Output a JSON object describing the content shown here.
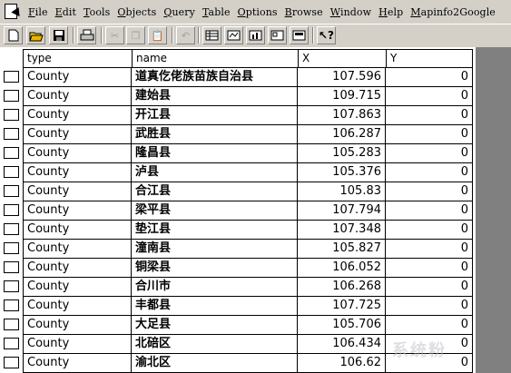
{
  "menu": [
    "File",
    "Edit",
    "Tools",
    "Objects",
    "Query",
    "Table",
    "Options",
    "Browse",
    "Window",
    "Help",
    "Mapinfo2Google"
  ],
  "columns": {
    "type": "type",
    "name": "name",
    "x": "X",
    "y": "Y"
  },
  "rows": [
    {
      "type": "County",
      "name": "道真仡佬族苗族自治县",
      "x": "107.596",
      "y": "0"
    },
    {
      "type": "County",
      "name": "建始县",
      "x": "109.715",
      "y": "0"
    },
    {
      "type": "County",
      "name": "开江县",
      "x": "107.863",
      "y": "0"
    },
    {
      "type": "County",
      "name": "武胜县",
      "x": "106.287",
      "y": "0"
    },
    {
      "type": "County",
      "name": "隆昌县",
      "x": "105.283",
      "y": "0"
    },
    {
      "type": "County",
      "name": "泸县",
      "x": "105.376",
      "y": "0"
    },
    {
      "type": "County",
      "name": "合江县",
      "x": "105.83",
      "y": "0"
    },
    {
      "type": "County",
      "name": "梁平县",
      "x": "107.794",
      "y": "0"
    },
    {
      "type": "County",
      "name": "垫江县",
      "x": "107.348",
      "y": "0"
    },
    {
      "type": "County",
      "name": "潼南县",
      "x": "105.827",
      "y": "0"
    },
    {
      "type": "County",
      "name": "铜梁县",
      "x": "106.052",
      "y": "0"
    },
    {
      "type": "County",
      "name": "合川市",
      "x": "106.268",
      "y": "0"
    },
    {
      "type": "County",
      "name": "丰都县",
      "x": "107.725",
      "y": "0"
    },
    {
      "type": "County",
      "name": "大足县",
      "x": "105.706",
      "y": "0"
    },
    {
      "type": "County",
      "name": "北碚区",
      "x": "106.434",
      "y": "0"
    },
    {
      "type": "County",
      "name": "渝北区",
      "x": "106.62",
      "y": "0"
    }
  ],
  "watermark": "系统粉"
}
